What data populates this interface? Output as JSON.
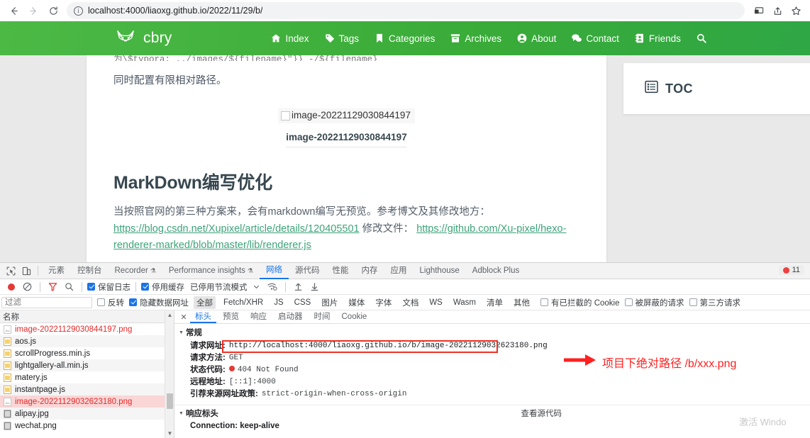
{
  "browser": {
    "back_icon": "back-arrow-icon",
    "forward_icon": "forward-arrow-icon",
    "reload_icon": "reload-icon",
    "url": "localhost:4000/liaoxg.github.io/2022/11/29/b/",
    "info_glyph": "i",
    "right_icons": [
      "cast-icon",
      "share-icon",
      "bookmark-star-icon"
    ]
  },
  "site": {
    "brand": "cbry",
    "logo_icon": "fox-head-logo-icon",
    "nav": [
      {
        "label": "Index",
        "icon": "home-icon"
      },
      {
        "label": "Tags",
        "icon": "tag-icon"
      },
      {
        "label": "Categories",
        "icon": "bookmark-icon"
      },
      {
        "label": "Archives",
        "icon": "archive-box-icon"
      },
      {
        "label": "About",
        "icon": "user-circle-icon"
      },
      {
        "label": "Contact",
        "icon": "comments-icon"
      },
      {
        "label": "Friends",
        "icon": "address-book-icon"
      }
    ],
    "search_icon": "search-icon"
  },
  "article": {
    "code_clip": "为\\$typora: ../images/${filename}\"}} -/${filename}",
    "para1": "同时配置有限相对路径。",
    "broken_image_alt": "image-20221129030844197",
    "image_caption": "image-20221129030844197",
    "heading": "MarkDown编写优化",
    "body_prefix": "当按照官网的第三种方案来，会有markdown编写无预览。参考博文及其修改地方：",
    "link1": "https://blog.csdn.net/Xupixel/article/details/120405501",
    "mid_text": "修改文件：",
    "link2": "https://github.com/Xu-pixel/hexo-renderer-marked/blob/master/lib/renderer.js"
  },
  "toc": {
    "title": "TOC",
    "icon": "list-box-icon"
  },
  "devtools": {
    "inspect_icon": "inspect-element-icon",
    "device_icon": "device-toolbar-icon",
    "tabs": [
      {
        "label": "元素",
        "active": false,
        "warn": false
      },
      {
        "label": "控制台",
        "active": false,
        "warn": false
      },
      {
        "label": "Recorder",
        "active": false,
        "warn": true
      },
      {
        "label": "Performance insights",
        "active": false,
        "warn": true
      },
      {
        "label": "网络",
        "active": true,
        "warn": false
      },
      {
        "label": "源代码",
        "active": false,
        "warn": false
      },
      {
        "label": "性能",
        "active": false,
        "warn": false
      },
      {
        "label": "内存",
        "active": false,
        "warn": false
      },
      {
        "label": "应用",
        "active": false,
        "warn": false
      },
      {
        "label": "Lighthouse",
        "active": false,
        "warn": false
      },
      {
        "label": "Adblock Plus",
        "active": false,
        "warn": false
      }
    ],
    "error_count": "11",
    "toolbar": {
      "record_icon": "record-stop-icon",
      "clear_icon": "clear-no-entry-icon",
      "filter_icon": "filter-funnel-icon",
      "search_icon": "search-icon",
      "preserve_log": "保留日志",
      "preserve_log_checked": true,
      "disable_cache": "停用缓存",
      "disable_cache_checked": true,
      "throttling": "已停用节流模式",
      "throttle_dropdown_icon": "chevron-down-icon",
      "wifi_icon": "network-conditions-icon",
      "import_icon": "import-har-icon",
      "export_icon": "export-har-icon"
    },
    "filterbar": {
      "placeholder": "过滤",
      "invert": "反转",
      "invert_checked": false,
      "hide_data_urls": "隐藏数据网址",
      "hide_data_urls_checked": true,
      "types": [
        "全部",
        "Fetch/XHR",
        "JS",
        "CSS",
        "图片",
        "媒体",
        "字体",
        "文档",
        "WS",
        "Wasm",
        "清单",
        "其他"
      ],
      "active_type": "全部",
      "blocked_cookies": "有已拦截的 Cookie",
      "blocked_requests": "被屏蔽的请求",
      "third_party": "第三方请求"
    },
    "list": {
      "header": "名称",
      "rows": [
        {
          "name": "image-20221129030844197.png",
          "icon": "image-file-icon",
          "error": true,
          "selected": false
        },
        {
          "name": "aos.js",
          "icon": "js-file-icon",
          "error": false,
          "selected": false
        },
        {
          "name": "scrollProgress.min.js",
          "icon": "js-file-icon",
          "error": false,
          "selected": false
        },
        {
          "name": "lightgallery-all.min.js",
          "icon": "js-file-icon",
          "error": false,
          "selected": false
        },
        {
          "name": "matery.js",
          "icon": "js-file-icon",
          "error": false,
          "selected": false
        },
        {
          "name": "instantpage.js",
          "icon": "js-file-icon",
          "error": false,
          "selected": false
        },
        {
          "name": "image-20221129032623180.png",
          "icon": "image-file-icon",
          "error": true,
          "selected": true
        },
        {
          "name": "alipay.jpg",
          "icon": "image-file-icon",
          "error": false,
          "selected": false
        },
        {
          "name": "wechat.png",
          "icon": "image-file-icon",
          "error": false,
          "selected": false
        }
      ]
    },
    "detail": {
      "close_icon": "close-icon",
      "tabs": [
        "标头",
        "预览",
        "响应",
        "启动器",
        "时间",
        "Cookie"
      ],
      "active_tab": "标头",
      "general_section": "常规",
      "fields": [
        {
          "key": "请求网址:",
          "value": "http://localhost:4000/liaoxg.github.io/b/image-20221129032623180.png"
        },
        {
          "key": "请求方法:",
          "value": "GET"
        },
        {
          "key": "状态代码:",
          "value": "404 Not Found",
          "status": true
        },
        {
          "key": "远程地址:",
          "value": "[::1]:4000"
        },
        {
          "key": "引荐来源网址政策:",
          "value": "strict-origin-when-cross-origin"
        }
      ],
      "response_section": "响应标头",
      "view_source": "查看源代码",
      "response_first": "Connection: keep-alive"
    }
  },
  "annotation": {
    "text": "项目下绝对路径 /b/xxx.png",
    "arrow_icon": "red-arrow-right-icon",
    "color": "#ff2020"
  },
  "watermark": "激活 Windo"
}
